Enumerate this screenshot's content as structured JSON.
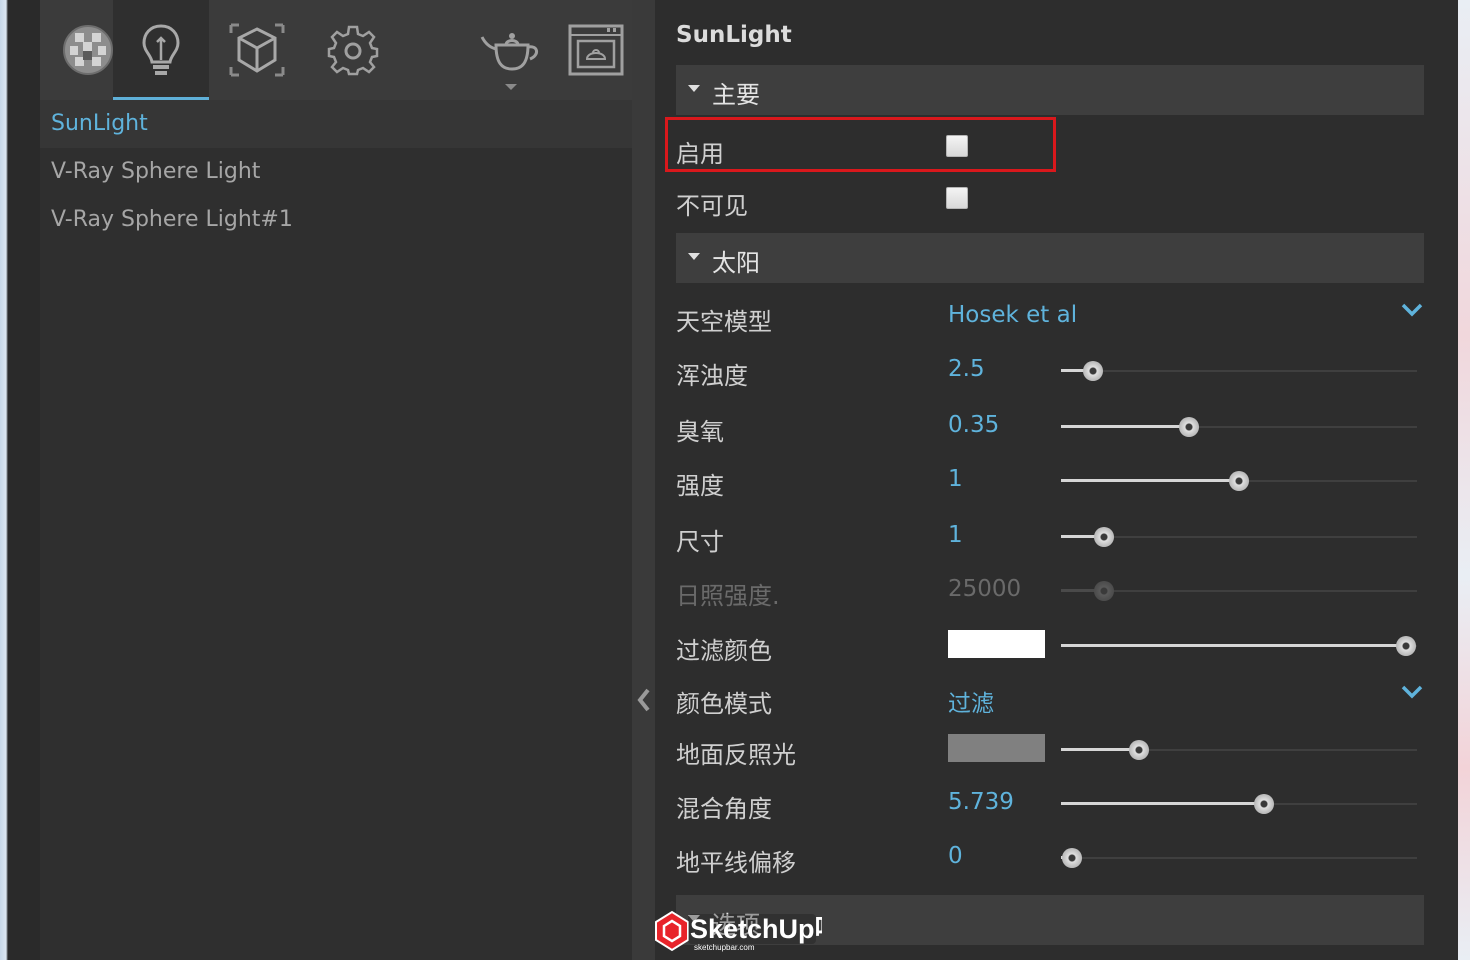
{
  "toolbar": {
    "tabs": [
      {
        "name": "materials",
        "icon": "material-sphere-icon"
      },
      {
        "name": "lights",
        "icon": "lightbulb-icon",
        "active": true
      },
      {
        "name": "geometry",
        "icon": "cube-icon"
      },
      {
        "name": "settings",
        "icon": "gear-icon"
      },
      {
        "name": "render",
        "icon": "teapot-icon",
        "has_dropdown": true
      },
      {
        "name": "frame-buffer",
        "icon": "frame-buffer-icon"
      }
    ]
  },
  "light_list": {
    "items": [
      {
        "label": "SunLight",
        "selected": true
      },
      {
        "label": "V-Ray Sphere Light",
        "selected": false
      },
      {
        "label": "V-Ray Sphere Light#1",
        "selected": false
      }
    ]
  },
  "properties": {
    "title": "SunLight",
    "sections": {
      "main": {
        "label": "主要"
      },
      "sun": {
        "label": "太阳"
      },
      "options": {
        "label": "选项"
      }
    },
    "main_rows": {
      "enable": {
        "label": "启用",
        "checked": false
      },
      "invisible": {
        "label": "不可见",
        "checked": false
      }
    },
    "sun_rows": {
      "sky_model": {
        "label": "天空模型",
        "value": "Hosek et al"
      },
      "turbidity": {
        "label": "浑浊度",
        "value": "2.5",
        "slider_fraction": 0.09
      },
      "ozone": {
        "label": "臭氧",
        "value": "0.35",
        "slider_fraction": 0.36
      },
      "intensity": {
        "label": "强度",
        "value": "1",
        "slider_fraction": 0.5
      },
      "size": {
        "label": "尺寸",
        "value": "1",
        "slider_fraction": 0.12
      },
      "illuminance": {
        "label": "日照强度.",
        "value": "25000",
        "slider_fraction": 0.12,
        "disabled": true
      },
      "filter_color": {
        "label": "过滤颜色",
        "color": "#ffffff",
        "slider_fraction": 0.97
      },
      "color_mode": {
        "label": "颜色模式",
        "value": "过滤"
      },
      "ground_albedo": {
        "label": "地面反照光",
        "color": "#808080",
        "slider_fraction": 0.22
      },
      "blend_angle": {
        "label": "混合角度",
        "value": "5.739",
        "slider_fraction": 0.57
      },
      "horizon_offset": {
        "label": "地平线偏移",
        "value": "0",
        "slider_fraction": 0.03
      }
    }
  },
  "watermark": {
    "text": "SketchUp吧",
    "subtext": "sketchupbar.com"
  },
  "colors": {
    "accent": "#5fb3dc",
    "highlight": "#d9181c"
  }
}
